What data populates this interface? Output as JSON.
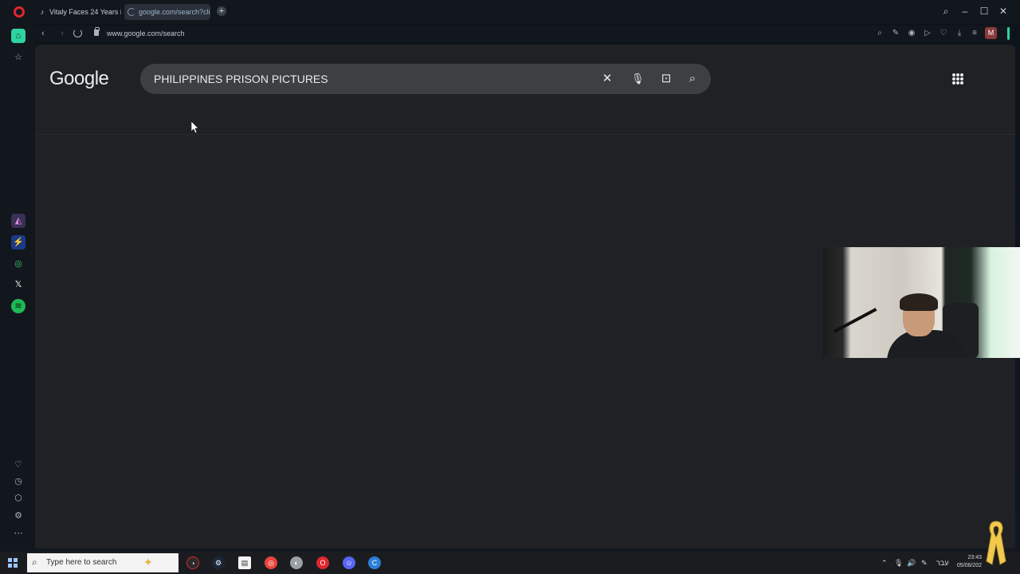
{
  "browser": {
    "tabs": [
      {
        "label": "Vitaly Faces 24 Years in Ph",
        "icon": "tiktok-icon"
      },
      {
        "label": "google.com/search?client",
        "icon": "loading-spinner-icon"
      }
    ],
    "new_tab_symbol": "+",
    "url": "www.google.com/search",
    "profile_initial": "M"
  },
  "google": {
    "logo_text": "Google",
    "query": "PHILIPPINES PRISON PICTURES",
    "colors": {
      "page_bg": "#202124",
      "searchbox_bg": "#3c4043",
      "text": "#e8eaed"
    }
  },
  "taskbar": {
    "search_placeholder": "Type here to search",
    "language": "עבר",
    "time": "23:43",
    "date": "05/06/202"
  },
  "colors": {
    "opera_red": "#e0262f",
    "accent_green": "#2fd3a0",
    "ribbon_yellow": "#f2c94c"
  }
}
